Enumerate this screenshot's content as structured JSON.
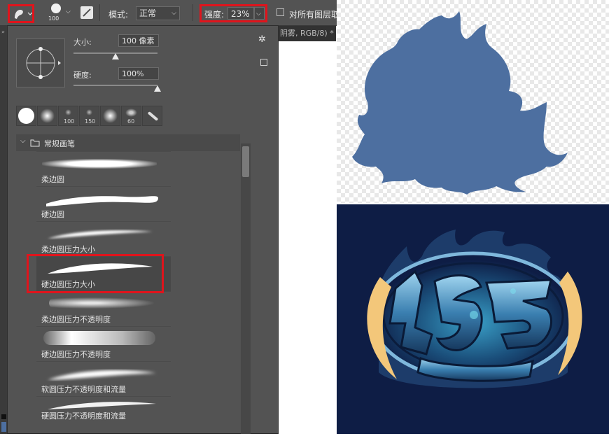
{
  "options_bar": {
    "brush_size": "100",
    "mode_label": "模式:",
    "mode_value": "正常",
    "strength_label": "强度:",
    "strength_value": "23%",
    "sample_all_label": "对所有图层取"
  },
  "brush_panel": {
    "size_label": "大小:",
    "size_value": "100 像素",
    "size_fraction": 0.5,
    "hardness_label": "硬度:",
    "hardness_value": "100%",
    "hardness_fraction": 1.0,
    "recent_presets": [
      {
        "label": ""
      },
      {
        "label": ""
      },
      {
        "label": "100"
      },
      {
        "label": "150"
      },
      {
        "label": ""
      },
      {
        "label": "60"
      },
      {
        "label": ""
      }
    ],
    "group_name": "常规画笔",
    "brushes": [
      {
        "label": "柔边圆"
      },
      {
        "label": "硬边圆"
      },
      {
        "label": "柔边圆压力大小"
      },
      {
        "label": "硬边圆压力大小",
        "selected": true
      },
      {
        "label": "柔边圆压力不透明度"
      },
      {
        "label": "硬边圆压力不透明度"
      },
      {
        "label": "软圆压力不透明度和流量"
      },
      {
        "label": "硬圆压力不透明度和流量"
      }
    ]
  },
  "document_tab": "阴雾, RGB/8) *",
  "colors": {
    "highlight": "#e0141c",
    "panel_bg": "#535353",
    "shape_fill": "#4d6fa0",
    "art_bg": "#0e1d45"
  }
}
